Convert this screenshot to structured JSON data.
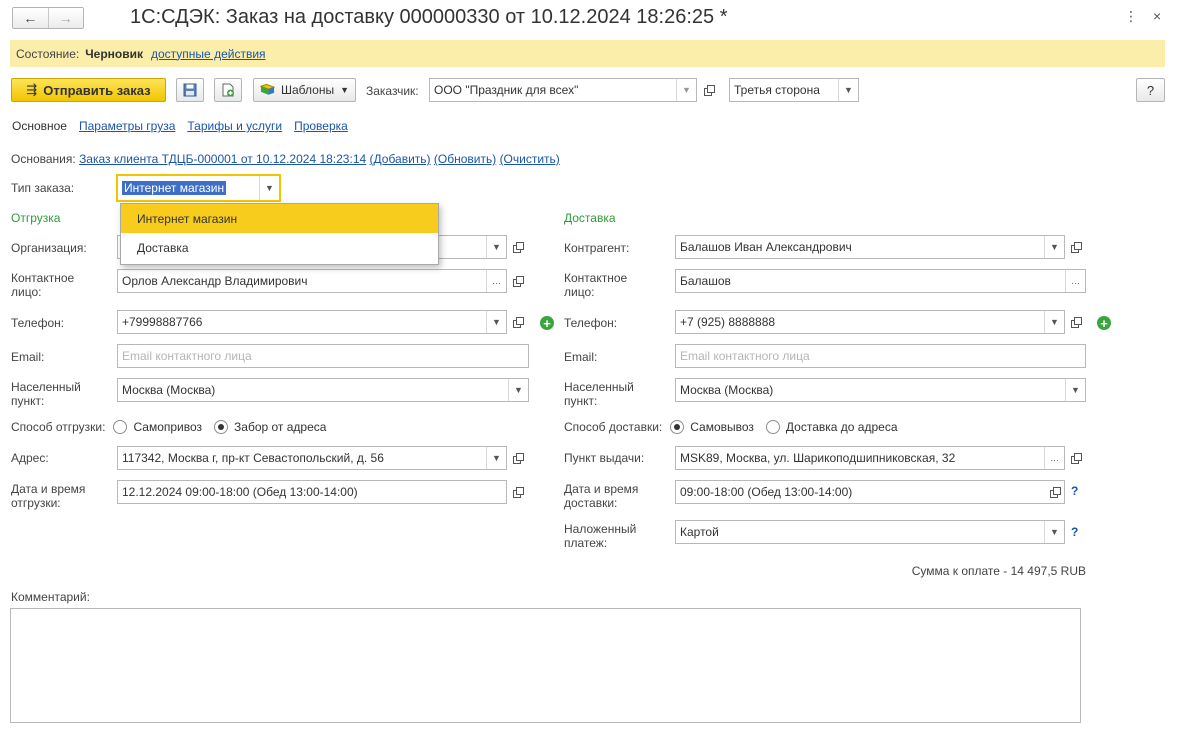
{
  "window": {
    "title": "1С:СДЭК: Заказ на доставку 000000330 от 10.12.2024 18:26:25 *",
    "nav_back": "←",
    "nav_forward": "→",
    "menu_glyph": "⋮",
    "close_glyph": "×"
  },
  "state_bar": {
    "label": "Состояние:",
    "value": "Черновик",
    "actions_link": "доступные действия"
  },
  "toolbar": {
    "send_button": "Отправить заказ",
    "templates_button": "Шаблоны",
    "customer_label": "Заказчик:",
    "customer_value": "ООО \"Праздник для всех\"",
    "third_party_value": "Третья сторона",
    "help_button": "?"
  },
  "tabs": [
    {
      "label": "Основное",
      "active": true
    },
    {
      "label": "Параметры груза",
      "active": false
    },
    {
      "label": "Тарифы и услуги",
      "active": false
    },
    {
      "label": "Проверка",
      "active": false
    }
  ],
  "basis": {
    "label": "Основания:",
    "link": "Заказ клиента ТДЦБ-000001 от 10.12.2024 18:23:14",
    "add": "(Добавить)",
    "update": "(Обновить)",
    "clear": "(Очистить)"
  },
  "order_type": {
    "label": "Тип заказа:",
    "value": "Интернет магазин",
    "options": [
      "Интернет магазин",
      "Доставка"
    ],
    "highlighted_option": 0
  },
  "shipment": {
    "section_title": "Отгрузка",
    "organization_label": "Организация:",
    "contact_label": "Контактное лицо:",
    "contact_value": "Орлов Александр Владимирович",
    "phone_label": "Телефон:",
    "phone_value": "+79998887766",
    "email_label": "Email:",
    "email_placeholder": "Email контактного лица",
    "city_label": "Населенный пункт:",
    "city_value": "Москва (Москва)",
    "method_label": "Способ отгрузки:",
    "method_options": [
      "Самопривоз",
      "Забор от адреса"
    ],
    "method_selected": 1,
    "address_label": "Адрес:",
    "address_value": "117342, Москва г, пр-кт Севастопольский, д. 56",
    "datetime_label": "Дата и время отгрузки:",
    "datetime_value": "12.12.2024 09:00-18:00 (Обед 13:00-14:00)"
  },
  "delivery": {
    "section_title": "Доставка",
    "counterparty_label": "Контрагент:",
    "counterparty_value": "Балашов Иван Александрович",
    "contact_label": "Контактное лицо:",
    "contact_value": "Балашов",
    "phone_label": "Телефон:",
    "phone_value": "+7 (925) 8888888",
    "email_label": "Email:",
    "email_placeholder": "Email контактного лица",
    "city_label": "Населенный пункт:",
    "city_value": "Москва (Москва)",
    "method_label": "Способ доставки:",
    "method_options": [
      "Самовывоз",
      "Доставка до адреса"
    ],
    "method_selected": 0,
    "pickup_label": "Пункт выдачи:",
    "pickup_value": "MSK89, Москва, ул. Шарикоподшипниковская, 32",
    "datetime_label": "Дата и время доставки:",
    "datetime_value": "09:00-18:00 (Обед 13:00-14:00)",
    "cod_label": "Наложенный платеж:",
    "cod_value": "Картой",
    "help_glyph": "?"
  },
  "total": "Сумма к оплате - 14 497,5 RUB",
  "comment": {
    "label": "Комментарий:",
    "value": ""
  },
  "colors": {
    "accent_yellow": "#f2c500",
    "state_bar": "#fbeeab",
    "link_blue": "#1a55a8",
    "section_green": "#2e9b3a",
    "selection_blue": "#3d6fc8"
  }
}
